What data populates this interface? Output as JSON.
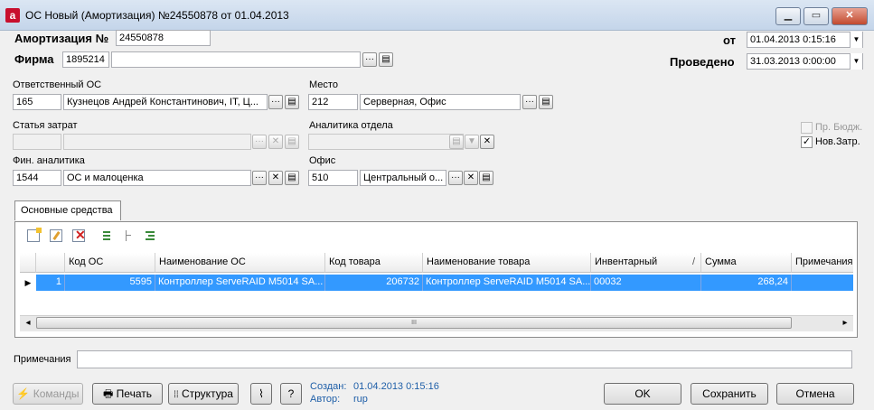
{
  "window": {
    "title": "ОС Новый (Амортизация) №24550878 от 01.04.2013",
    "app_icon_letter": "a",
    "min_glyph": "▁",
    "max_glyph": "▭",
    "close_glyph": "✕"
  },
  "header": {
    "amort_label": "Амортизация №",
    "amort_value": "24550878",
    "firm_label": "Фирма",
    "firm_code": "1895214",
    "firm_name": "",
    "from_label": "от",
    "from_value": "01.04.2013 0:15:16",
    "posted_label": "Проведено",
    "posted_value": "31.03.2013 0:00:00"
  },
  "fields": {
    "responsible_label": "Ответственный ОС",
    "responsible_code": "165",
    "responsible_name": "Кузнецов Андрей Константинович, IT, Ц...",
    "place_label": "Место",
    "place_code": "212",
    "place_name": "Серверная, Офис",
    "cost_item_label": "Статья затрат",
    "cost_item_code": "",
    "cost_item_name": "",
    "dept_analytics_label": "Аналитика отдела",
    "dept_analytics_value": "",
    "fin_analytics_label": "Фин. аналитика",
    "fin_analytics_code": "1544",
    "fin_analytics_name": "ОС и малоценка",
    "office_label": "Офис",
    "office_code": "510",
    "office_name": "Центральный о...",
    "pr_budget_label": "Пр. Бюдж.",
    "new_costs_label": "Нов.Затр.",
    "new_costs_checked": "✓"
  },
  "glyphs": {
    "ellipsis": "···",
    "clear": "✕",
    "open": "▤",
    "dropdown": "▼",
    "current_row": "▶",
    "sort": "/",
    "scroll_left": "◂",
    "scroll_right": "▸",
    "scroll_grip": "III"
  },
  "tabs": {
    "assets_label": "Основные средства"
  },
  "grid": {
    "columns": [
      "Код ОС",
      "Наименование ОС",
      "Код товара",
      "Наименование товара",
      "Инвентарный",
      "Сумма",
      "Примечания"
    ],
    "rows": [
      {
        "num": "1",
        "code": "5595",
        "name": "Контроллер ServeRAID M5014 SA...",
        "goods_code": "206732",
        "goods_name": "Контроллер ServeRAID M5014 SA...",
        "inventory": "00032",
        "sum": "268,24",
        "notes": ""
      }
    ]
  },
  "notes": {
    "label": "Примечания",
    "value": ""
  },
  "footer": {
    "commands_label": "Команды",
    "print_label": "Печать",
    "structure_label": "Структура",
    "help_label": "?",
    "created_label": "Создан:",
    "created_value": "01.04.2013 0:15:16",
    "author_label": "Автор:",
    "author_value": "rup",
    "ok_label": "OK",
    "save_label": "Сохранить",
    "cancel_label": "Отмена"
  },
  "colors": {
    "selection": "#3399ff",
    "link_blue": "#1f5fa8"
  }
}
